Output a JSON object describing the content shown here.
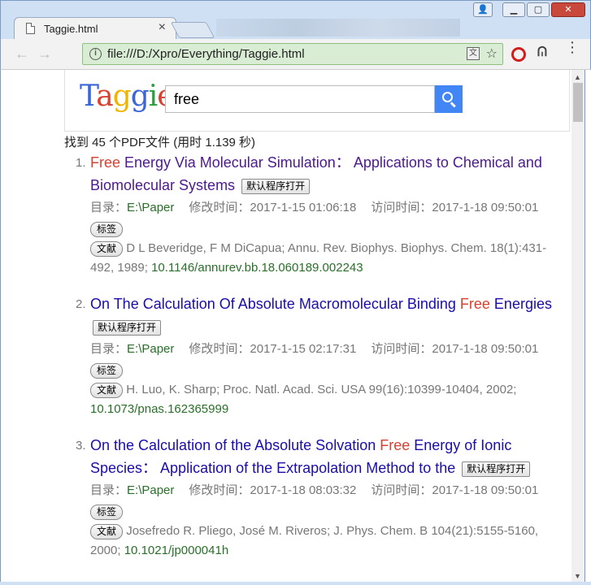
{
  "browser": {
    "tab_title": "Taggie.html",
    "tab_close": "×",
    "url": "file:///D:/Xpro/Everything/Taggie.html",
    "back": "←",
    "forward": "→",
    "star": "☆",
    "menu": "⋮"
  },
  "search": {
    "logo": [
      "T",
      "a",
      "g",
      "g",
      "i",
      "e"
    ],
    "query": "free",
    "summary": "找到 45 个PDF文件 (用时 1.139 秒)"
  },
  "labels": {
    "open_default": "默认程序打开",
    "dir_label": "目录：",
    "modified_label": "修改时间：",
    "accessed_label": "访问时间：",
    "tag_button": "标签",
    "cite_button": "文献"
  },
  "results": [
    {
      "num": "1.",
      "title_before": "",
      "title_hl": "Free",
      "title_after": " Energy Via Molecular Simulation： Applications to Chemical and Biomolecular Systems",
      "dir": "E:\\Paper",
      "modified": "2017-1-15 01:06:18",
      "accessed": "2017-1-18 09:50:01",
      "citation": "D L Beveridge, F M DiCapua; Annu. Rev. Biophys. Biophys. Chem. 18(1):431-492, 1989;",
      "doi": "10.1146/annurev.bb.18.060189.002243"
    },
    {
      "num": "2.",
      "title_before": "On The Calculation Of Absolute Macromolecular Binding ",
      "title_hl": "Free",
      "title_after": " Energies",
      "dir": "E:\\Paper",
      "modified": "2017-1-15 02:17:31",
      "accessed": "2017-1-18 09:50:01",
      "citation": "H. Luo, K. Sharp; Proc. Natl. Acad. Sci. USA 99(16):10399-10404, 2002;",
      "doi": "10.1073/pnas.162365999"
    },
    {
      "num": "3.",
      "title_before": "On the Calculation of the Absolute Solvation ",
      "title_hl": "Free",
      "title_after": " Energy of Ionic Species： Application of the Extrapolation Method to the",
      "dir": "E:\\Paper",
      "modified": "2017-1-18 08:03:32",
      "accessed": "2017-1-18 09:50:01",
      "citation": "Josefredo R. Pliego, José M. Riveros; J. Phys. Chem. B 104(21):5155-5160, 2000;",
      "doi": "10.1021/jp000041h"
    }
  ]
}
